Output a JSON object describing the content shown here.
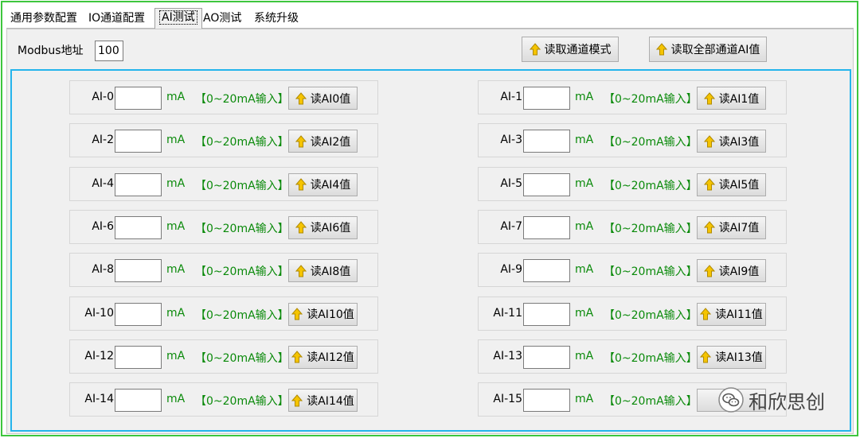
{
  "tabs": [
    {
      "label": "通用参数配置",
      "active": false
    },
    {
      "label": "IO通道配置",
      "active": false
    },
    {
      "label": "AI测试",
      "active": true
    },
    {
      "label": "AO测试",
      "active": false
    },
    {
      "label": "系统升级",
      "active": false
    }
  ],
  "modbus": {
    "label": "Modbus地址",
    "value": "100"
  },
  "toolbar": {
    "read_mode_label": "读取通道模式",
    "read_all_label": "读取全部通道AI值"
  },
  "channels": [
    {
      "name": "AI-0",
      "value": "",
      "unit": "mA",
      "range": "【0~20mA输入】",
      "button": "读AI0值"
    },
    {
      "name": "AI-1",
      "value": "",
      "unit": "mA",
      "range": "【0~20mA输入】",
      "button": "读AI1值"
    },
    {
      "name": "AI-2",
      "value": "",
      "unit": "mA",
      "range": "【0~20mA输入】",
      "button": "读AI2值"
    },
    {
      "name": "AI-3",
      "value": "",
      "unit": "mA",
      "range": "【0~20mA输入】",
      "button": "读AI3值"
    },
    {
      "name": "AI-4",
      "value": "",
      "unit": "mA",
      "range": "【0~20mA输入】",
      "button": "读AI4值"
    },
    {
      "name": "AI-5",
      "value": "",
      "unit": "mA",
      "range": "【0~20mA输入】",
      "button": "读AI5值"
    },
    {
      "name": "AI-6",
      "value": "",
      "unit": "mA",
      "range": "【0~20mA输入】",
      "button": "读AI6值"
    },
    {
      "name": "AI-7",
      "value": "",
      "unit": "mA",
      "range": "【0~20mA输入】",
      "button": "读AI7值"
    },
    {
      "name": "AI-8",
      "value": "",
      "unit": "mA",
      "range": "【0~20mA输入】",
      "button": "读AI8值"
    },
    {
      "name": "AI-9",
      "value": "",
      "unit": "mA",
      "range": "【0~20mA输入】",
      "button": "读AI9值"
    },
    {
      "name": "AI-10",
      "value": "",
      "unit": "mA",
      "range": "【0~20mA输入】",
      "button": "读AI10值"
    },
    {
      "name": "AI-11",
      "value": "",
      "unit": "mA",
      "range": "【0~20mA输入】",
      "button": "读AI11值"
    },
    {
      "name": "AI-12",
      "value": "",
      "unit": "mA",
      "range": "【0~20mA输入】",
      "button": "读AI12值"
    },
    {
      "name": "AI-13",
      "value": "",
      "unit": "mA",
      "range": "【0~20mA输入】",
      "button": "读AI13值"
    },
    {
      "name": "AI-14",
      "value": "",
      "unit": "mA",
      "range": "【0~20mA输入】",
      "button": "读AI14值"
    },
    {
      "name": "AI-15",
      "value": "",
      "unit": "mA",
      "range": "【0~20mA输入】",
      "button": ""
    }
  ],
  "watermark": {
    "text": "和欣思创",
    "icon": "wechat-icon"
  },
  "colors": {
    "frame": "#3ec63e",
    "ai_border": "#24b4ec",
    "range_text": "#0a8a0a",
    "arrow": "#f5c400"
  }
}
